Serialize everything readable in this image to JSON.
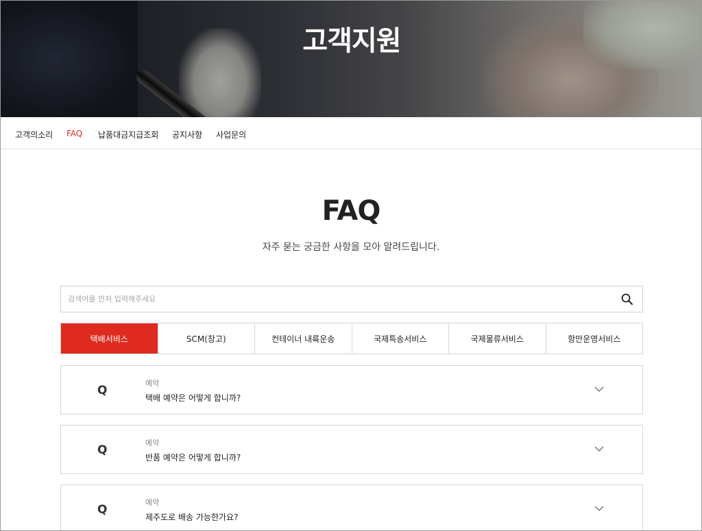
{
  "hero": {
    "title": "고객지원"
  },
  "subnav": {
    "items": [
      {
        "label": "고객의소리",
        "active": false
      },
      {
        "label": "FAQ",
        "active": true
      },
      {
        "label": "납품대금지급조회",
        "active": false
      },
      {
        "label": "공지사항",
        "active": false
      },
      {
        "label": "사업문의",
        "active": false
      }
    ]
  },
  "main": {
    "title": "FAQ",
    "subtitle": "자주 묻는 궁금한 사항을 모아 알려드립니다."
  },
  "search": {
    "placeholder": "검색어를 먼저 입력해주세요",
    "value": "",
    "icon": "search-icon"
  },
  "tabs": [
    {
      "label": "택배서비스",
      "active": true
    },
    {
      "label": "SCM(창고)",
      "active": false
    },
    {
      "label": "컨테이너 내륙운송",
      "active": false
    },
    {
      "label": "국제특송서비스",
      "active": false
    },
    {
      "label": "국제물류서비스",
      "active": false
    },
    {
      "label": "항만운영서비스",
      "active": false
    }
  ],
  "faqs": [
    {
      "marker": "Q",
      "category": "예약",
      "question": "택배 예약은 어떻게 합니까?"
    },
    {
      "marker": "Q",
      "category": "예약",
      "question": "반품 예약은 어떻게 합니까?"
    },
    {
      "marker": "Q",
      "category": "예약",
      "question": "제주도로 배송 가능한가요?"
    }
  ],
  "colors": {
    "accent": "#df2a1f",
    "active_text": "#e2291e",
    "border": "#d5d5d5"
  }
}
